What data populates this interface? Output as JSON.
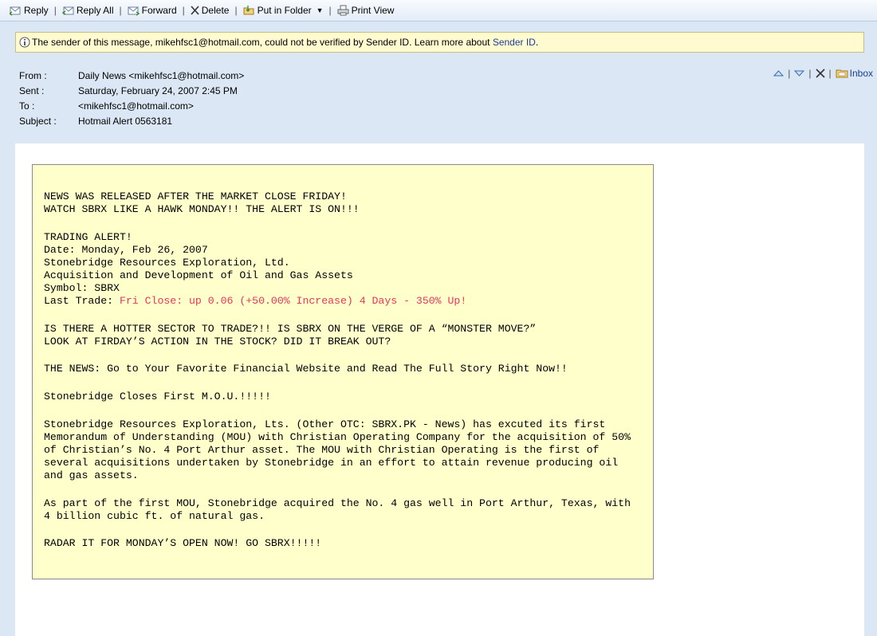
{
  "toolbar": {
    "reply": "Reply",
    "reply_all": "Reply All",
    "forward": "Forward",
    "delete": "Delete",
    "put_in_folder": "Put in Folder",
    "print_view": "Print View"
  },
  "warning": {
    "text": "The sender of this message, mikehfsc1@hotmail.com, could not be verified by Sender ID. Learn more about ",
    "link": "Sender ID",
    "end": "."
  },
  "header": {
    "from_label": "From :",
    "from_value": "Daily News <mikehfsc1@hotmail.com>",
    "sent_label": "Sent :",
    "sent_value": "Saturday, February 24, 2007 2:45 PM",
    "to_label": "To :",
    "to_value": "<mikehfsc1@hotmail.com>",
    "subject_label": "Subject :",
    "subject_value": "Hotmail Alert 0563181",
    "inbox": "Inbox"
  },
  "body": {
    "l1": "NEWS WAS RELEASED AFTER THE MARKET CLOSE FRIDAY!",
    "l2": "WATCH SBRX LIKE A HAWK MONDAY!! THE ALERT IS ON!!!",
    "l3": "TRADING ALERT!",
    "l4": "Date: Monday, Feb 26, 2007",
    "l5": "Stonebridge Resources Exploration, Ltd.",
    "l6": "Acquisition and Development of Oil and Gas Assets",
    "l7": "Symbol: SBRX",
    "l8_label": "Last Trade: ",
    "l8_value": "Fri Close: up 0.06 (+50.00% Increase) 4 Days - 350% Up!",
    "l9": "IS THERE A HOTTER SECTOR TO TRADE?!! IS SBRX ON THE VERGE OF A “MONSTER MOVE?”",
    "l10": "LOOK AT FIRDAY’S ACTION IN THE STOCK? DID IT BREAK OUT?",
    "l11": "THE NEWS: Go to Your Favorite Financial Website and Read The Full Story Right Now!!",
    "l12": "Stonebridge Closes First M.O.U.!!!!!",
    "l13": "Stonebridge Resources Exploration, Lts. (Other OTC: SBRX.PK - News) has excuted its first",
    "l14": "Memorandum of Understanding (MOU) with Christian Operating Company for the acquisition of 50%",
    "l15": "of Christian’s No. 4 Port Arthur asset. The MOU with Christian Operating is the first of",
    "l16": "several acquisitions undertaken by Stonebridge in an effort to attain revenue producing oil",
    "l17": "and gas assets.",
    "l18": "As part of the first MOU, Stonebridge acquired the No. 4 gas well in Port Arthur, Texas, with",
    "l19": "4 billion cubic ft. of natural gas.",
    "l20": "RADAR IT FOR MONDAY’S OPEN NOW! GO SBRX!!!!!"
  },
  "colors": {
    "accent_link": "#1c3f94",
    "highlight_red": "#e8365a",
    "note_background": "#ffffcc",
    "warning_background": "#fffad0"
  }
}
